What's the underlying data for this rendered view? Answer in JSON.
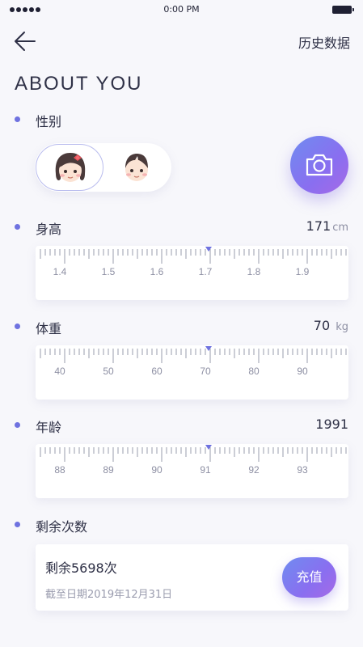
{
  "status_bar": {
    "time": "0:00 PM"
  },
  "header": {
    "history_label": "历史数据"
  },
  "title": "ABOUT YOU",
  "gender": {
    "label": "性别",
    "selected": "girl"
  },
  "height": {
    "label": "身高",
    "value": "171",
    "unit": "cm",
    "ticks": [
      "1.4",
      "1.5",
      "1.6",
      "1.7",
      "1.8",
      "1.9"
    ]
  },
  "weight": {
    "label": "体重",
    "value": "70",
    "unit": "kg",
    "ticks": [
      "40",
      "50",
      "60",
      "70",
      "80",
      "90"
    ]
  },
  "age": {
    "label": "年龄",
    "value": "1991",
    "ticks": [
      "88",
      "89",
      "90",
      "91",
      "92",
      "93"
    ]
  },
  "remaining": {
    "label": "剩余次数",
    "count_text": "剩余5698次",
    "expiry_text": "截至日期2019年12月31日",
    "recharge_label": "充值"
  },
  "colors": {
    "accent": "#6f72e0",
    "gradient_start": "#6f8cf0",
    "gradient_end": "#a66ae6"
  }
}
